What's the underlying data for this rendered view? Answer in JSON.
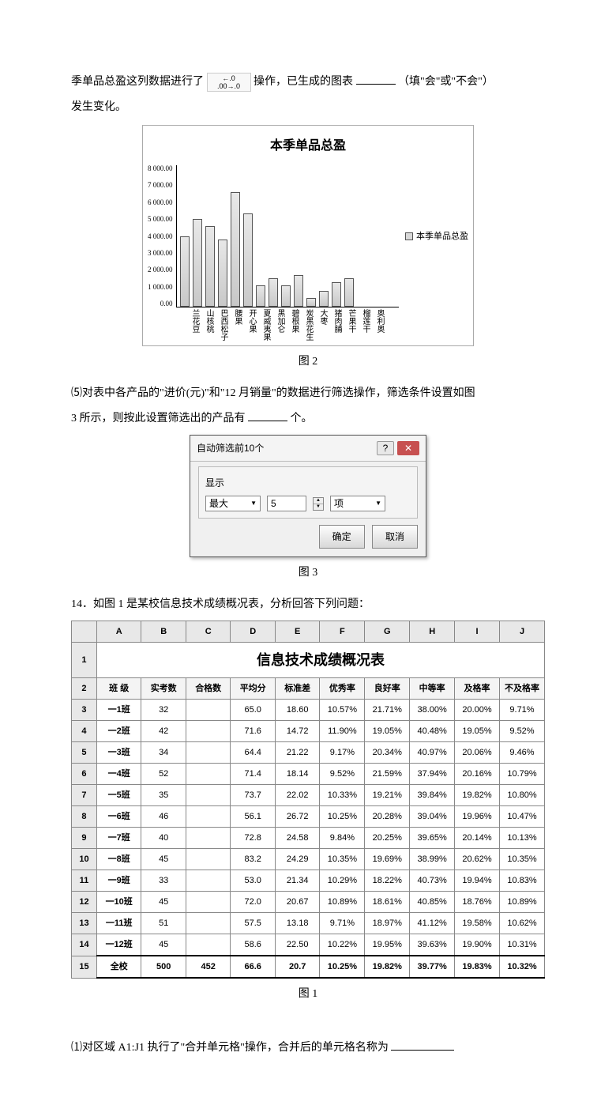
{
  "text": {
    "p1a": "季单品总盈这列数据进行了 ",
    "p1b": " 操作，已生成的图表",
    "p1c": "（填\"会\"或\"不会\"）",
    "p1d": "发生变化。",
    "iconTop": "←.0",
    "iconBot": ".00→.0",
    "cap2": "图 2",
    "p5a": "⑸对表中各产品的\"进价(元)\"和\"12 月销量\"的数据进行筛选操作，筛选条件设置如图",
    "p5b": "3 所示，则按此设置筛选出的产品有",
    "p5c": "个。",
    "cap3": "图 3",
    "q14": "14．如图 1 是某校信息技术成绩概况表，分析回答下列问题：",
    "cap1b": "图 1",
    "sub1a": "⑴对区域 A1:J1 执行了\"合并单元格\"操作，合并后的单元格名称为"
  },
  "chart_data": {
    "type": "bar",
    "title": "本季单品总盈",
    "legend": "本季单品总盈",
    "ylabel": "",
    "ylim": [
      0,
      8000
    ],
    "yticks": [
      "8 000.00",
      "7 000.00",
      "6 000.00",
      "5 000.00",
      "4 000.00",
      "3 000.00",
      "2 000.00",
      "1 000.00",
      "0.00"
    ],
    "categories": [
      "兰花豆",
      "山核桃",
      "巴西松子",
      "腰果",
      "开心果",
      "夏威夷果",
      "黑加仑",
      "碧根果",
      "炭黑花生",
      "大枣",
      "猪肉脯",
      "芒果干",
      "榴莲干",
      "奥利奥"
    ],
    "values": [
      4000,
      5000,
      4600,
      3800,
      6500,
      5300,
      1200,
      1600,
      1200,
      1800,
      500,
      900,
      1400,
      1600
    ]
  },
  "dialog": {
    "title": "自动筛选前10个",
    "groupLabel": "显示",
    "select1": "最大",
    "input": "5",
    "select2": "项",
    "ok": "确定",
    "cancel": "取消"
  },
  "xl": {
    "cols": [
      "A",
      "B",
      "C",
      "D",
      "E",
      "F",
      "G",
      "H",
      "I",
      "J"
    ],
    "rownums": [
      "1",
      "2",
      "3",
      "4",
      "5",
      "6",
      "7",
      "8",
      "9",
      "10",
      "11",
      "12",
      "13",
      "14",
      "15"
    ],
    "mergedTitle": "信息技术成绩概况表",
    "headers": [
      "班 级",
      "实考数",
      "合格数",
      "平均分",
      "标准差",
      "优秀率",
      "良好率",
      "中等率",
      "及格率",
      "不及格率"
    ],
    "rows": [
      [
        "一1班",
        "32",
        "",
        "65.0",
        "18.60",
        "10.57%",
        "21.71%",
        "38.00%",
        "20.00%",
        "9.71%"
      ],
      [
        "一2班",
        "42",
        "",
        "71.6",
        "14.72",
        "11.90%",
        "19.05%",
        "40.48%",
        "19.05%",
        "9.52%"
      ],
      [
        "一3班",
        "34",
        "",
        "64.4",
        "21.22",
        "9.17%",
        "20.34%",
        "40.97%",
        "20.06%",
        "9.46%"
      ],
      [
        "一4班",
        "52",
        "",
        "71.4",
        "18.14",
        "9.52%",
        "21.59%",
        "37.94%",
        "20.16%",
        "10.79%"
      ],
      [
        "一5班",
        "35",
        "",
        "73.7",
        "22.02",
        "10.33%",
        "19.21%",
        "39.84%",
        "19.82%",
        "10.80%"
      ],
      [
        "一6班",
        "46",
        "",
        "56.1",
        "26.72",
        "10.25%",
        "20.28%",
        "39.04%",
        "19.96%",
        "10.47%"
      ],
      [
        "一7班",
        "40",
        "",
        "72.8",
        "24.58",
        "9.84%",
        "20.25%",
        "39.65%",
        "20.14%",
        "10.13%"
      ],
      [
        "一8班",
        "45",
        "",
        "83.2",
        "24.29",
        "10.35%",
        "19.69%",
        "38.99%",
        "20.62%",
        "10.35%"
      ],
      [
        "一9班",
        "33",
        "",
        "53.0",
        "21.34",
        "10.29%",
        "18.22%",
        "40.73%",
        "19.94%",
        "10.83%"
      ],
      [
        "一10班",
        "45",
        "",
        "72.0",
        "20.67",
        "10.89%",
        "18.61%",
        "40.85%",
        "18.76%",
        "10.89%"
      ],
      [
        "一11班",
        "51",
        "",
        "57.5",
        "13.18",
        "9.71%",
        "18.97%",
        "41.12%",
        "19.58%",
        "10.62%"
      ],
      [
        "一12班",
        "45",
        "",
        "58.6",
        "22.50",
        "10.22%",
        "19.95%",
        "39.63%",
        "19.90%",
        "10.31%"
      ]
    ],
    "totalRow": [
      "全校",
      "500",
      "452",
      "66.6",
      "20.7",
      "10.25%",
      "19.82%",
      "39.77%",
      "19.83%",
      "10.32%"
    ]
  }
}
